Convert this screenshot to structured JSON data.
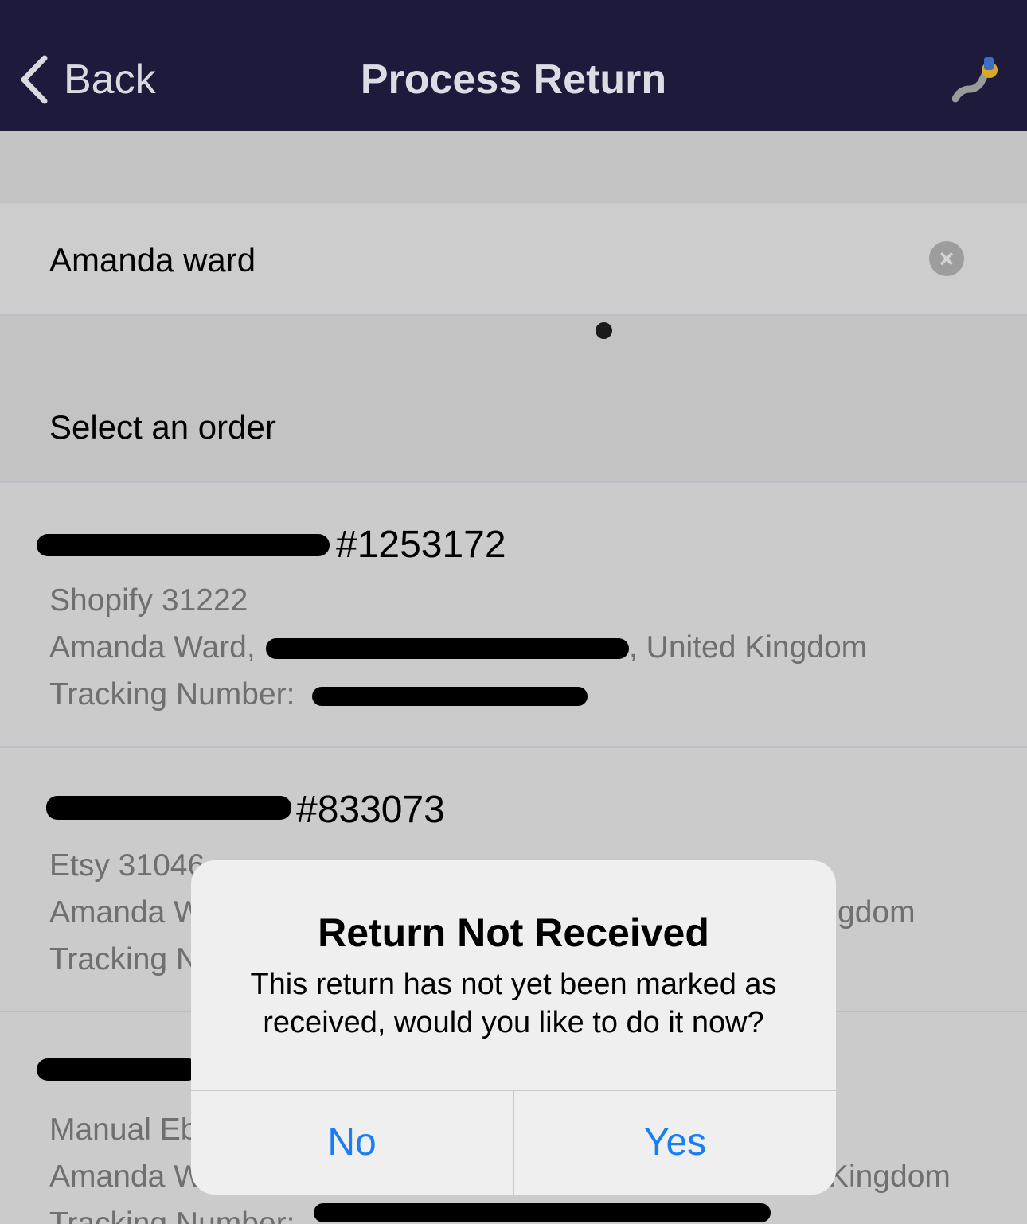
{
  "navbar": {
    "back_label": "Back",
    "title": "Process Return",
    "right_icon": "user-avatar-icon"
  },
  "search": {
    "value": "Amanda ward"
  },
  "section": {
    "title": "Select an order"
  },
  "orders": [
    {
      "number": "#1253172",
      "source": "Shopify 31222",
      "customer_prefix": "Amanda Ward,",
      "customer_suffix": ", United Kingdom",
      "tracking_label": "Tracking Number:"
    },
    {
      "number": "#833073",
      "source": "Etsy 31046",
      "customer_prefix": "Amanda W",
      "customer_suffix": "gdom",
      "tracking_label": "Tracking N"
    },
    {
      "number": "",
      "source": "Manual Eb",
      "customer_prefix": "Amanda W",
      "customer_suffix": "Kingdom",
      "tracking_label": "Tracking Number:"
    }
  ],
  "dialog": {
    "title": "Return Not Received",
    "message": "This return has not yet been marked as received, would you like to do it now?",
    "no_label": "No",
    "yes_label": "Yes"
  },
  "colors": {
    "navbar": "#1e1a3c",
    "dialog_button": "#1a7ef3"
  }
}
